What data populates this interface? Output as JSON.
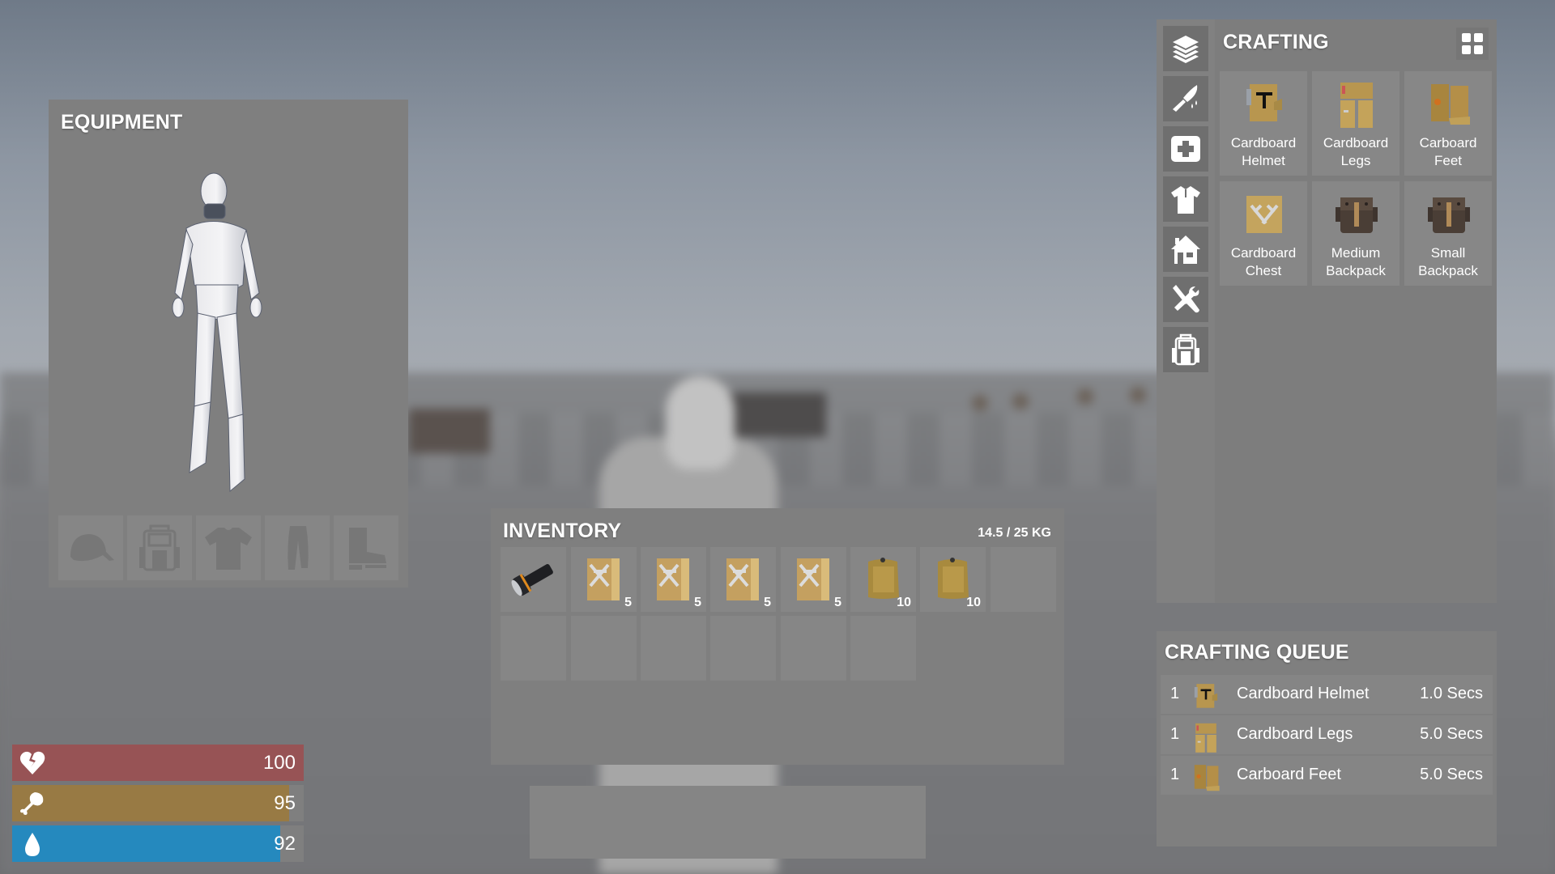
{
  "equipment": {
    "title": "EQUIPMENT",
    "character": "player-mannequin",
    "slots": [
      {
        "name": "head",
        "icon": "cap-icon"
      },
      {
        "name": "backpack",
        "icon": "backpack-icon"
      },
      {
        "name": "torso",
        "icon": "tshirt-icon"
      },
      {
        "name": "legs",
        "icon": "pants-icon"
      },
      {
        "name": "feet",
        "icon": "boot-icon"
      }
    ]
  },
  "inventory": {
    "title": "INVENTORY",
    "weight": "14.5 / 25 KG",
    "slots": [
      {
        "item": "Flashlight",
        "icon": "flashlight-icon",
        "count": ""
      },
      {
        "item": "Cardboard Chest",
        "icon": "cardboard-chest-icon",
        "count": "5"
      },
      {
        "item": "Cardboard Chest",
        "icon": "cardboard-chest-icon",
        "count": "5"
      },
      {
        "item": "Cardboard Chest",
        "icon": "cardboard-chest-icon",
        "count": "5"
      },
      {
        "item": "Cardboard Chest",
        "icon": "cardboard-chest-icon",
        "count": "5"
      },
      {
        "item": "Cardboard",
        "icon": "cardboard-sheet-icon",
        "count": "10"
      },
      {
        "item": "Cardboard",
        "icon": "cardboard-sheet-icon",
        "count": "10"
      },
      {
        "item": "",
        "icon": "",
        "count": ""
      },
      {
        "item": "",
        "icon": "",
        "count": ""
      },
      {
        "item": "",
        "icon": "",
        "count": ""
      },
      {
        "item": "",
        "icon": "",
        "count": ""
      },
      {
        "item": "",
        "icon": "",
        "count": ""
      },
      {
        "item": "",
        "icon": "",
        "count": ""
      },
      {
        "item": "",
        "icon": "",
        "count": ""
      }
    ]
  },
  "hotbar": {
    "slots": 6
  },
  "stats": [
    {
      "name": "health",
      "icon": "broken-heart-icon",
      "value": "100",
      "fraction": 1.0,
      "color": "#975355"
    },
    {
      "name": "hunger",
      "icon": "drumstick-icon",
      "value": "95",
      "fraction": 0.95,
      "color": "#987a44"
    },
    {
      "name": "thirst",
      "icon": "water-drop-icon",
      "value": "92",
      "fraction": 0.92,
      "color": "#2589be"
    }
  ],
  "crafting": {
    "title": "CRAFTING",
    "view_toggle_icon": "grid-view-icon",
    "categories": [
      {
        "name": "all",
        "icon": "layers-icon"
      },
      {
        "name": "weapons",
        "icon": "knife-icon"
      },
      {
        "name": "medical",
        "icon": "medkit-icon"
      },
      {
        "name": "clothing",
        "icon": "shirt-icon"
      },
      {
        "name": "building",
        "icon": "house-icon"
      },
      {
        "name": "tools",
        "icon": "tools-icon"
      },
      {
        "name": "backpacks",
        "icon": "backpack-icon"
      }
    ],
    "recipes": [
      {
        "line1": "Cardboard",
        "line2": "Helmet",
        "kind": "helmet"
      },
      {
        "line1": "Cardboard",
        "line2": "Legs",
        "kind": "legs"
      },
      {
        "line1": "Carboard",
        "line2": "Feet",
        "kind": "feet"
      },
      {
        "line1": "Cardboard",
        "line2": "Chest",
        "kind": "chest"
      },
      {
        "line1": "Medium",
        "line2": "Backpack",
        "kind": "backpack"
      },
      {
        "line1": "Small",
        "line2": "Backpack",
        "kind": "backpack"
      }
    ]
  },
  "queue": {
    "title": "CRAFTING QUEUE",
    "items": [
      {
        "qty": "1",
        "name": "Cardboard Helmet",
        "time": "1.0 Secs",
        "kind": "helmet"
      },
      {
        "qty": "1",
        "name": "Cardboard Legs",
        "time": "5.0 Secs",
        "kind": "legs"
      },
      {
        "qty": "1",
        "name": "Carboard Feet",
        "time": "5.0 Secs",
        "kind": "feet"
      }
    ]
  }
}
